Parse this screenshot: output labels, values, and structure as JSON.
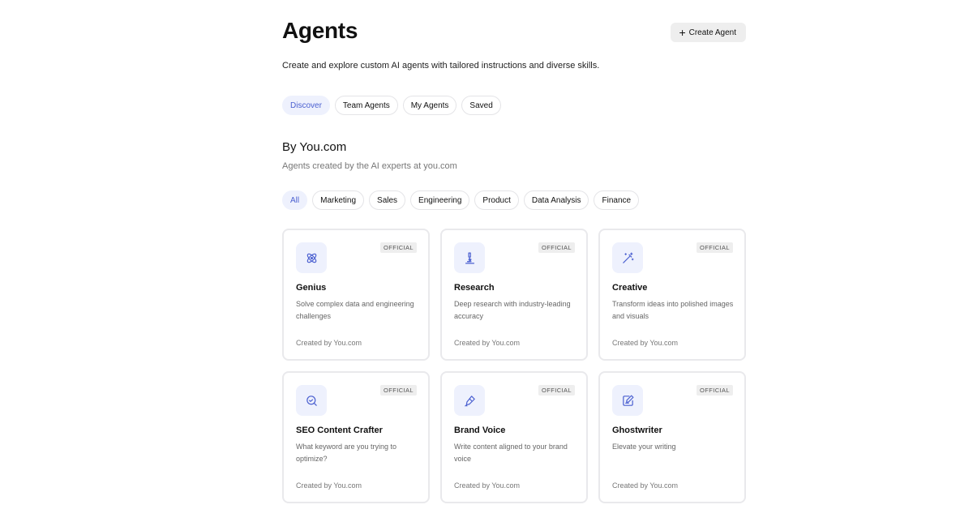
{
  "header": {
    "title": "Agents",
    "create_label": "Create Agent"
  },
  "subtitle": "Create and explore custom AI agents with tailored instructions and diverse skills.",
  "main_tabs": [
    {
      "label": "Discover",
      "active": true
    },
    {
      "label": "Team Agents",
      "active": false
    },
    {
      "label": "My Agents",
      "active": false
    },
    {
      "label": "Saved",
      "active": false
    }
  ],
  "section": {
    "title": "By You.com",
    "subtitle": "Agents created by the AI experts at you.com"
  },
  "filters": [
    {
      "label": "All",
      "active": true
    },
    {
      "label": "Marketing",
      "active": false
    },
    {
      "label": "Sales",
      "active": false
    },
    {
      "label": "Engineering",
      "active": false
    },
    {
      "label": "Product",
      "active": false
    },
    {
      "label": "Data Analysis",
      "active": false
    },
    {
      "label": "Finance",
      "active": false
    }
  ],
  "cards": [
    {
      "icon": "atom-icon",
      "badge": "OFFICIAL",
      "title": "Genius",
      "description": "Solve complex data and engineering challenges",
      "author": "Created by You.com"
    },
    {
      "icon": "microscope-icon",
      "badge": "OFFICIAL",
      "title": "Research",
      "description": "Deep research with industry-leading accuracy",
      "author": "Created by You.com"
    },
    {
      "icon": "magic-wand-icon",
      "badge": "OFFICIAL",
      "title": "Creative",
      "description": "Transform ideas into polished images and visuals",
      "author": "Created by You.com"
    },
    {
      "icon": "search-icon",
      "badge": "OFFICIAL",
      "title": "SEO Content Crafter",
      "description": "What keyword are you trying to optimize?",
      "author": "Created by You.com"
    },
    {
      "icon": "pen-icon",
      "badge": "OFFICIAL",
      "title": "Brand Voice",
      "description": "Write content aligned to your brand voice",
      "author": "Created by You.com"
    },
    {
      "icon": "edit-note-icon",
      "badge": "OFFICIAL",
      "title": "Ghostwriter",
      "description": "Elevate your writing",
      "author": "Created by You.com"
    }
  ],
  "colors": {
    "accent": "#4a5fd0",
    "accent_bg": "#eef1fd",
    "card_border": "#e9e9ec"
  }
}
